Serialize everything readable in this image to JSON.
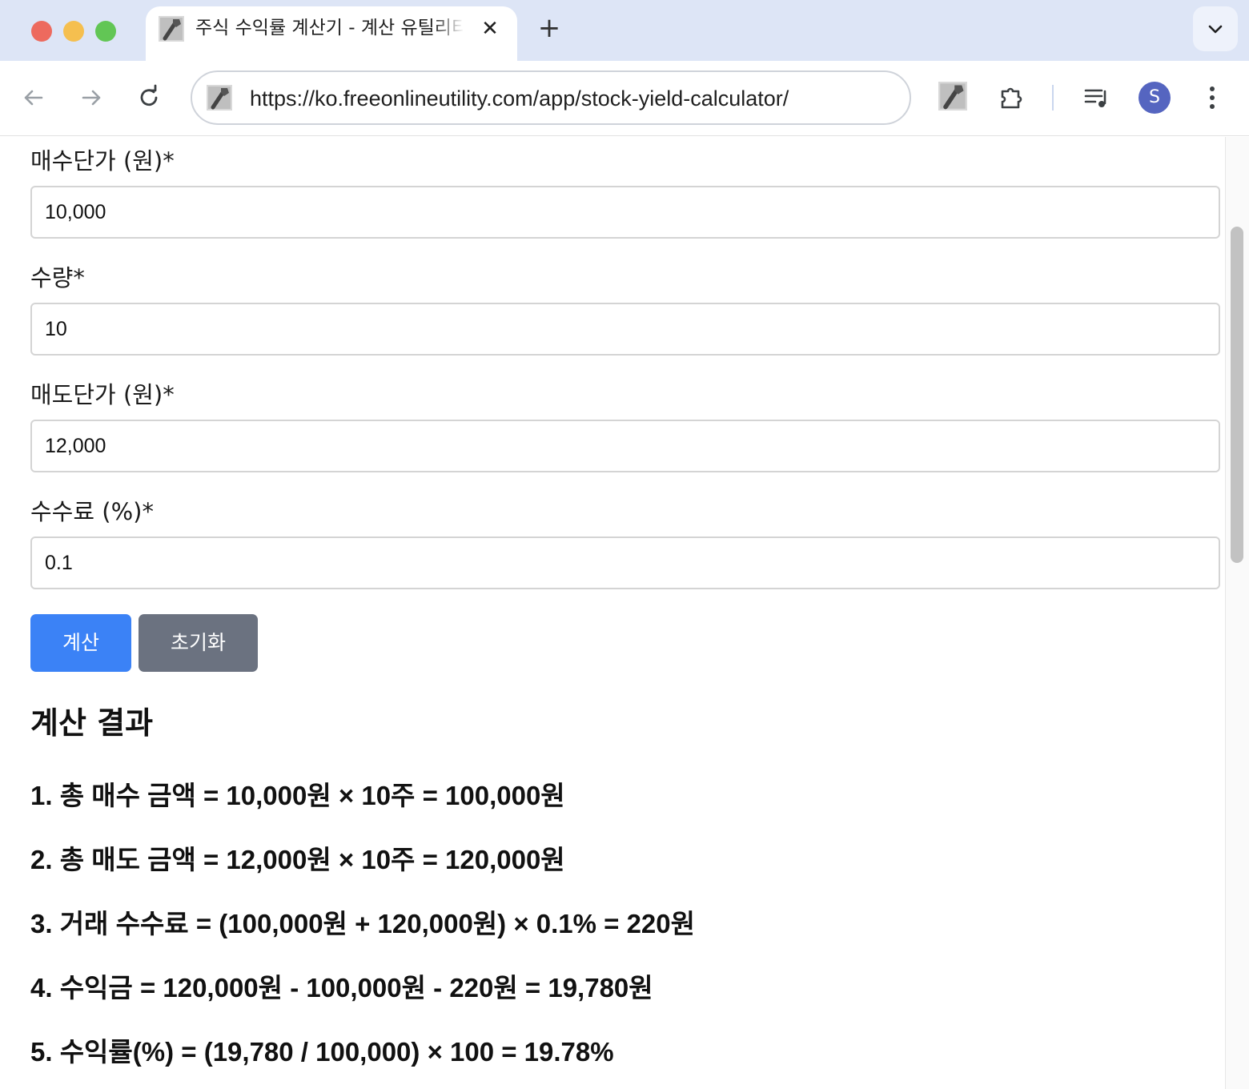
{
  "browser": {
    "tab_title": "주식 수익률 계산기 - 계산 유틸리티",
    "tab_close": "✕",
    "new_tab": "+",
    "url": "https://ko.freeonlineutility.com/app/stock-yield-calculator/",
    "avatar_letter": "S",
    "icons": [
      "back-arrow-icon",
      "forward-arrow-icon",
      "reload-icon",
      "extensions-puzzle-icon",
      "media-playlist-icon",
      "more-vert-icon",
      "tab-search-chevron-icon"
    ]
  },
  "form": {
    "buy_price": {
      "label": "매수단가 (원)*",
      "value": "10,000"
    },
    "quantity": {
      "label": "수량*",
      "value": "10"
    },
    "sell_price": {
      "label": "매도단가 (원)*",
      "value": "12,000"
    },
    "fee": {
      "label": "수수료 (%)*",
      "value": "0.1"
    },
    "calculate_label": "계산",
    "reset_label": "초기화"
  },
  "result": {
    "title": "계산 결과",
    "lines": [
      "1. 총 매수 금액 = 10,000원 × 10주 = 100,000원",
      "2. 총 매도 금액 = 12,000원 × 10주 = 120,000원",
      "3. 거래 수수료 = (100,000원 + 120,000원) × 0.1% = 220원",
      "4. 수익금 = 120,000원 - 100,000원 - 220원 = 19,780원",
      "5. 수익률(%) = (19,780 / 100,000) × 100 = 19.78%"
    ]
  },
  "colors": {
    "calculate_button": "#3b82f6",
    "reset_button": "#6b7280",
    "tabstrip": "#dde5f6",
    "avatar": "#5565c0"
  }
}
